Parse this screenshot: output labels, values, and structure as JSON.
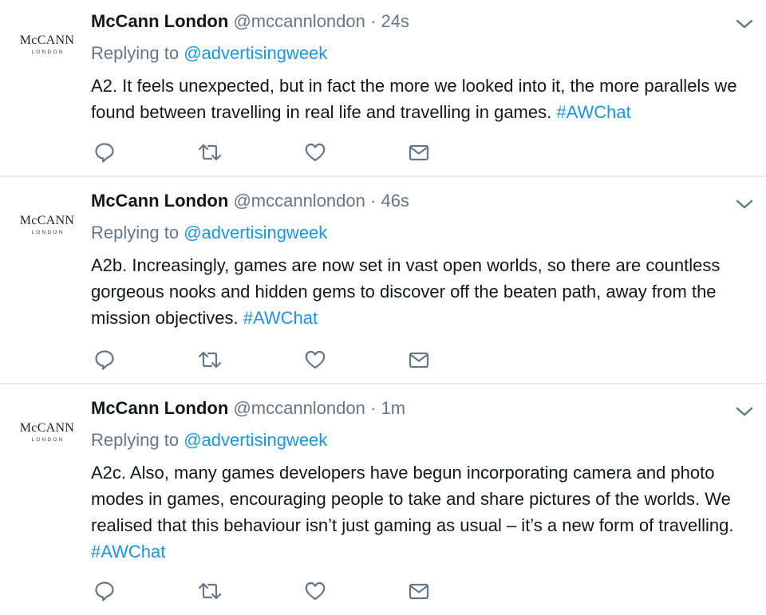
{
  "tweets": [
    {
      "author_name": "McCann London",
      "handle": "@mccannlondon",
      "separator": "·",
      "time": "24s",
      "replying_prefix": "Replying to",
      "replying_to": "@advertisingweek",
      "text": "A2. It feels unexpected, but in fact the more we looked into it, the more parallels we found between travelling in real life and travelling in games.",
      "hashtag": "#AWChat",
      "avatar": {
        "logo_prefix": "Mc",
        "logo_main": "CANN",
        "logo_sub": "LONDON"
      }
    },
    {
      "author_name": "McCann London",
      "handle": "@mccannlondon",
      "separator": "·",
      "time": "46s",
      "replying_prefix": "Replying to",
      "replying_to": "@advertisingweek",
      "text": "A2b. Increasingly, games are now set in vast open worlds, so there are countless gorgeous nooks and hidden gems to discover off the beaten path, away from the mission objectives.",
      "hashtag": "#AWChat",
      "avatar": {
        "logo_prefix": "Mc",
        "logo_main": "CANN",
        "logo_sub": "LONDON"
      }
    },
    {
      "author_name": "McCann London",
      "handle": "@mccannlondon",
      "separator": "·",
      "time": "1m",
      "replying_prefix": "Replying to",
      "replying_to": "@advertisingweek",
      "text": "A2c. Also, many games developers have begun incorporating camera and photo modes in games, encouraging people to take and share pictures of the worlds. We realised that this behaviour isn’t just gaming as usual – it’s a new form of travelling.",
      "hashtag": "#AWChat",
      "avatar": {
        "logo_prefix": "Mc",
        "logo_main": "CANN",
        "logo_sub": "LONDON"
      }
    }
  ],
  "icons": {
    "reply": "reply-icon",
    "retweet": "retweet-icon",
    "like": "heart-icon",
    "dm": "envelope-icon",
    "menu": "chevron-down-icon"
  },
  "colors": {
    "link": "#1b95e0",
    "muted": "#657786",
    "text": "#14171a",
    "divider": "#e6ecf0"
  }
}
